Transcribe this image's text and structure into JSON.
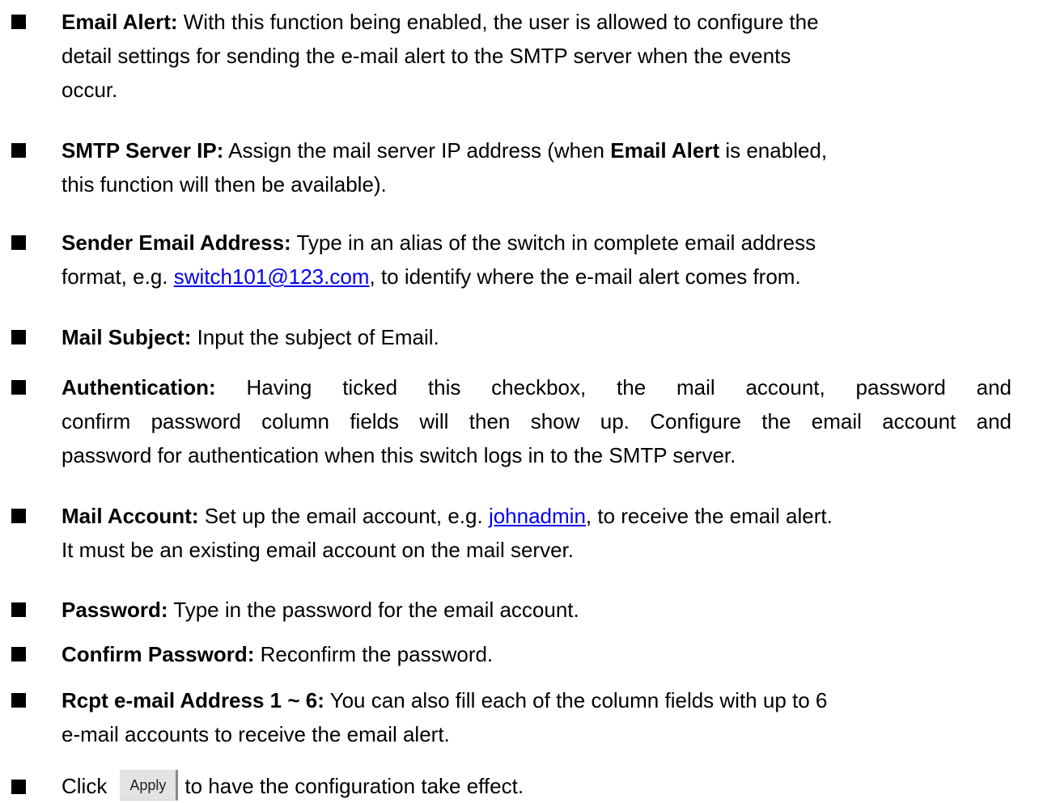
{
  "items": [
    {
      "label": "Email Alert:",
      "lines": [
        " With this function being enabled, the user is allowed to configure the",
        "detail settings for sending the e-mail alert to the SMTP server when the events",
        "occur."
      ]
    },
    {
      "label": "SMTP Server IP:",
      "text_before": " Assign the mail server IP address (when ",
      "bold_inline": "Email Alert",
      "text_after": " is enabled,",
      "line2": "this function will then be available)."
    },
    {
      "label": "Sender Email Address:",
      "line1": " Type in an alias of the switch in complete email address",
      "line2_before": "format, e.g. ",
      "link": "switch101@123.com",
      "line2_after": ", to identify where the e-mail alert comes from."
    },
    {
      "label": "Mail Subject:",
      "text": " Input the subject of Email."
    },
    {
      "label": "Authentication:",
      "lines": [
        " Having ticked this checkbox, the mail account, password and",
        "confirm password column fields will then show up. Configure the email account and",
        "password for authentication when this switch logs in to the SMTP server."
      ]
    },
    {
      "label": "Mail Account:",
      "line1_before": " Set up the email account, e.g. ",
      "link": "johnadmin",
      "line1_after": ", to receive the email alert.",
      "line2": "It must be an existing email account on the mail server."
    },
    {
      "label": "Password:",
      "text": " Type in the password for the email account."
    },
    {
      "label": "Confirm Password:",
      "text": " Reconfirm the password."
    },
    {
      "label": "Rcpt e-mail Address 1 ~ 6:",
      "line1": " You can also fill each of the column fields with up to 6",
      "line2": "e-mail accounts to receive the email alert."
    },
    {
      "text_before": "Click",
      "button_label": "Apply",
      "text_after": "to have the configuration take effect."
    }
  ]
}
